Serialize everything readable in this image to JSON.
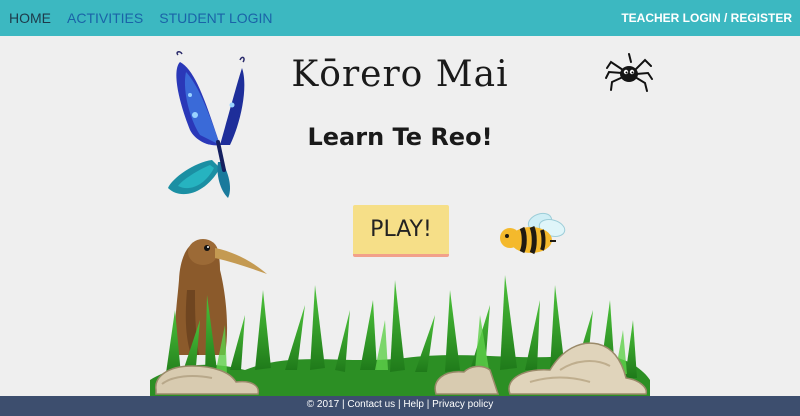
{
  "nav": {
    "items": [
      {
        "label": "HOME"
      },
      {
        "label": "ACTIVITIES"
      },
      {
        "label": "STUDENT LOGIN"
      }
    ],
    "teacher_login": "TEACHER LOGIN / REGISTER"
  },
  "hero": {
    "title": "Kōrero Mai",
    "subtitle": "Learn Te Reo!",
    "play_label": "PLAY!"
  },
  "footer": {
    "year": "© 2017",
    "sep": "|",
    "contact": "Contact us",
    "help": "Help",
    "privacy": "Privacy policy"
  },
  "colors": {
    "navbar": "#3cb8c1",
    "nav_link": "#1a63a8",
    "background": "#efefef",
    "play_button": "#f6df88",
    "footer": "#3d4e6e"
  },
  "icons": [
    "butterfly-icon",
    "spider-icon",
    "bee-icon",
    "kiwi-bird-icon",
    "grass-icon",
    "rock-icon"
  ]
}
